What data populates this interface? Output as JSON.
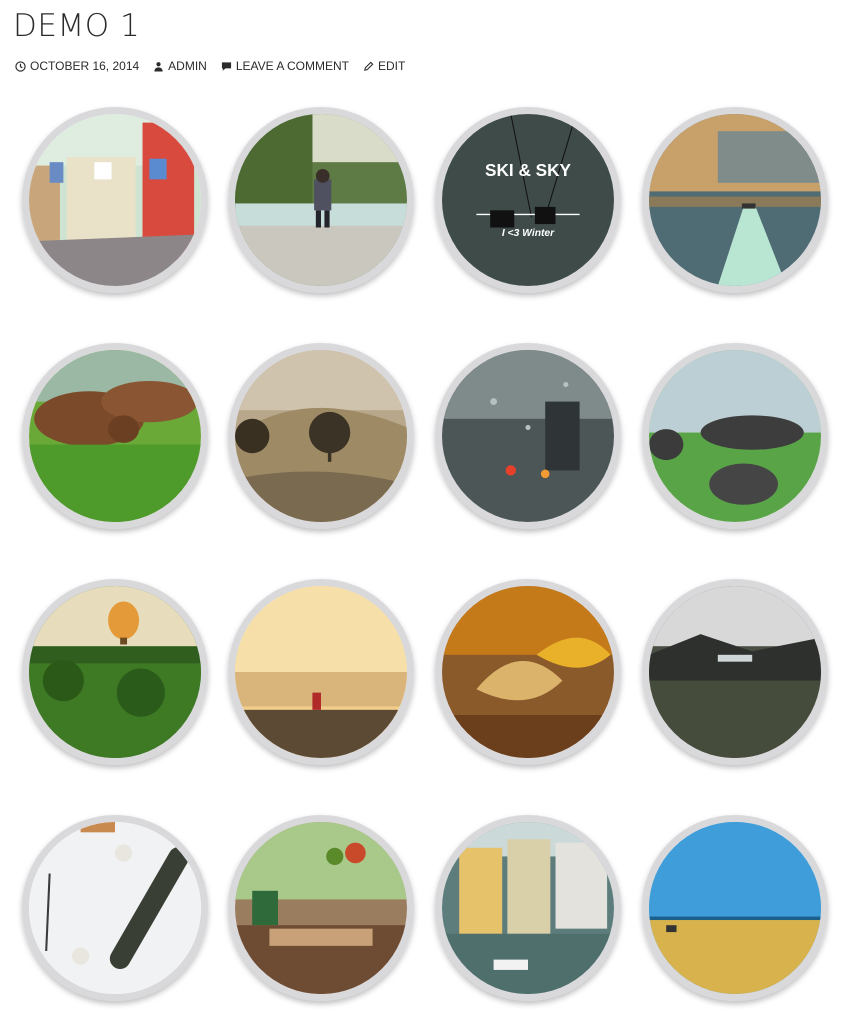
{
  "post": {
    "title": "DEMO 1",
    "date": "OCTOBER 16, 2014",
    "author": "ADMIN",
    "comment_link": "LEAVE A COMMENT",
    "edit_link": "EDIT"
  },
  "gallery": {
    "images": [
      {
        "subject": "colorful street with laundry"
      },
      {
        "subject": "man sitting by river"
      },
      {
        "subject": "ski lift gondolas",
        "title": "SKI & SKY",
        "caption": "I <3 Winter"
      },
      {
        "subject": "boat wake on lake at sunset"
      },
      {
        "subject": "cows grazing on grass"
      },
      {
        "subject": "trees on sepia hillside"
      },
      {
        "subject": "raindrops on window at night"
      },
      {
        "subject": "large stones in field"
      },
      {
        "subject": "hot air balloon over palms"
      },
      {
        "subject": "person in field at sunrise"
      },
      {
        "subject": "autumn leaves close-up"
      },
      {
        "subject": "mountain valley in mist"
      },
      {
        "subject": "skateboard on white wall"
      },
      {
        "subject": "cafe interior with plants"
      },
      {
        "subject": "canal with houses and boats"
      },
      {
        "subject": "wheat field under blue sky"
      }
    ]
  },
  "colors": {
    "text": "#2b2b2b",
    "ring": "#d2d2d6"
  }
}
